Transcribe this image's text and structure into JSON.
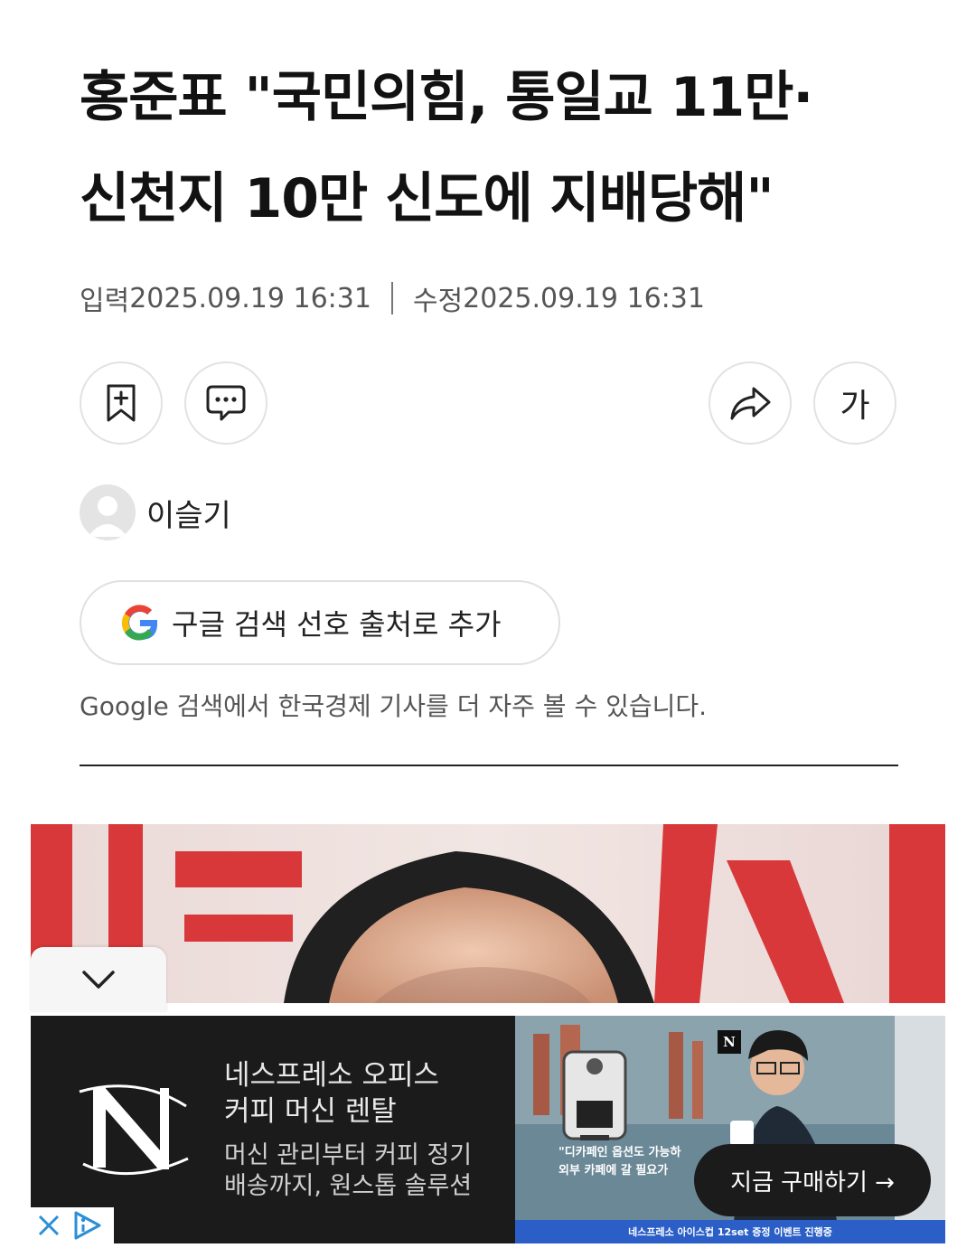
{
  "article": {
    "headline_line1": "홍준표 \"국민의힘, 통일교 11만·",
    "headline_line2": "신천지 10만 신도에 지배당해\"",
    "input_label": "입력",
    "input_date": "2025.09.19 16:31",
    "modified_label": "수정",
    "modified_date": "2025.09.19 16:31"
  },
  "toolbar": {
    "bookmark_icon": "bookmark-add-icon",
    "comment_icon": "comment-icon",
    "share_icon": "share-icon",
    "font_size_label": "가"
  },
  "reporter": {
    "name": "이슬기",
    "avatar_icon": "user-avatar-icon"
  },
  "google_pref": {
    "button_label": "구글 검색 선호 출처로 추가",
    "note": "Google 검색에서 한국경제 기사를 더 자주 볼 수 있습니다."
  },
  "ad": {
    "title_line1": "네스프레소 오피스",
    "title_line2": "커피 머신 렌탈",
    "desc_line1": "머신 관리부터 커피 정기",
    "desc_line2": "배송까지, 원스톱 솔루션",
    "quote_line1": "\"디카페인 옵션도 가능하",
    "quote_line2": "외부 카페에 갈 필요가",
    "strip_text": "네스프레소 아이스컵 12set 증정 이벤트 진행중",
    "cta_label": "지금 구매하기 →",
    "brand_badge": "N"
  },
  "colors": {
    "ad_background": "#1b1b1c",
    "photo_red": "#d8383a",
    "strip_blue": "#2b5fc7"
  }
}
